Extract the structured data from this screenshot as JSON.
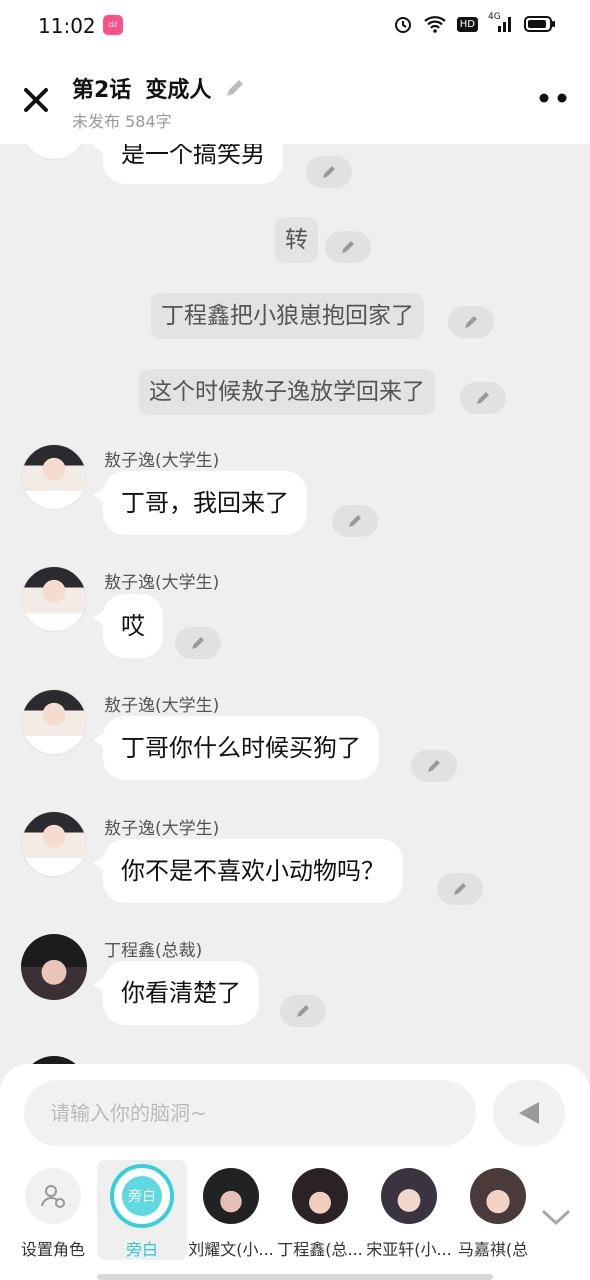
{
  "status": {
    "time": "11:02",
    "app_badge": "dz",
    "network": "4G",
    "hd": "HD"
  },
  "header": {
    "episode": "第2话",
    "title": "变成人",
    "meta": "未发布 584字"
  },
  "messages": [
    {
      "type": "bubble",
      "text": "是一个搞笑男"
    },
    {
      "type": "narration",
      "text": "转"
    },
    {
      "type": "narration",
      "text": "丁程鑫把小狼崽抱回家了"
    },
    {
      "type": "narration",
      "text": "这个时候敖子逸放学回来了"
    },
    {
      "type": "bubble",
      "speaker": "敖子逸(大学生)",
      "text": "丁哥，我回来了"
    },
    {
      "type": "bubble",
      "speaker": "敖子逸(大学生)",
      "text": "哎"
    },
    {
      "type": "bubble",
      "speaker": "敖子逸(大学生)",
      "text": "丁哥你什么时候买狗了"
    },
    {
      "type": "bubble",
      "speaker": "敖子逸(大学生)",
      "text": "你不是不喜欢小动物吗？"
    },
    {
      "type": "bubble",
      "speaker": "丁程鑫(总裁)",
      "text": "你看清楚了"
    }
  ],
  "composer": {
    "placeholder": "请输入你的脑洞~"
  },
  "roles": [
    {
      "label": "设置角色"
    },
    {
      "label": "旁白",
      "avatar_text": "旁白",
      "selected": true
    },
    {
      "label": "刘耀文(小..."
    },
    {
      "label": "丁程鑫(总..."
    },
    {
      "label": "宋亚轩(小..."
    },
    {
      "label": "马嘉祺(总"
    }
  ],
  "colors": {
    "accent": "#35d0da",
    "background": "#efefef",
    "bubble": "#ffffff"
  }
}
